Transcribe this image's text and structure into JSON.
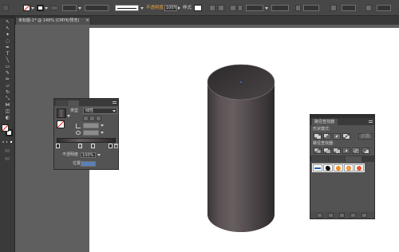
{
  "document": {
    "tab_title": "未标题-1* @ 149% (CMYK/预览)"
  },
  "control_bar": {
    "opacity_label": "不透明度",
    "opacity_value": "100%",
    "style_label": "样式"
  },
  "toolbar": {
    "tools": [
      "selection-tool-icon",
      "direct-selection-tool-icon",
      "magic-wand-tool-icon",
      "lasso-tool-icon",
      "pen-tool-icon",
      "type-tool-icon",
      "line-segment-tool-icon",
      "rectangle-tool-icon",
      "paintbrush-tool-icon",
      "pencil-tool-icon",
      "eraser-tool-icon",
      "rotate-tool-icon",
      "scale-tool-icon",
      "width-tool-icon",
      "free-transform-tool-icon",
      "shape-builder-tool-icon"
    ]
  },
  "gradient_panel": {
    "type_label": "类型",
    "type_value": "线性",
    "opacity_label": "不透明度",
    "opacity_value": "100%",
    "location_label": "位置"
  },
  "pathfinder_panel": {
    "title": "路径查找器",
    "shape_modes_label": "形状模式:",
    "pathfinders_label": "路径查找器:",
    "expand_label": "扩展"
  },
  "colors": {
    "link_orange": "#e3a23e",
    "canvas": "#ffffff",
    "workspace": "#5d5d5d",
    "selection_blue": "#3b6fd8",
    "location_field_blue": "#5b7fb6"
  }
}
